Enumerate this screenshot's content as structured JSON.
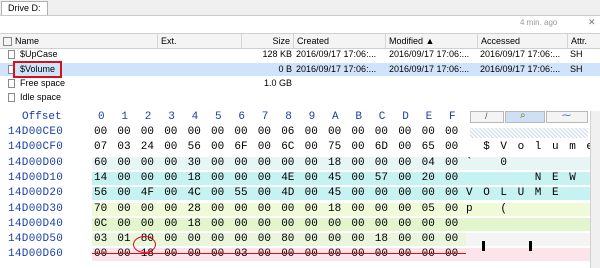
{
  "tab": {
    "label": "Drive D:"
  },
  "status": {
    "time_ago": "4 min. ago"
  },
  "file_list": {
    "columns": [
      "Name",
      "Ext.",
      "Size",
      "Created",
      "Modified",
      "Accessed",
      "Attr."
    ],
    "rows": [
      {
        "name": "$UpCase",
        "ext": "",
        "size": "128 KB",
        "created": "2016/09/17 17:06:...",
        "modified": "2016/09/17 17:06:...",
        "accessed": "2016/09/17 17:06:...",
        "attr": "SH",
        "selected": false
      },
      {
        "name": "$Volume",
        "ext": "",
        "size": "0 B",
        "created": "2016/09/17 17:06:...",
        "modified": "2016/09/17 17:06:...",
        "accessed": "2016/09/17 17:06:...",
        "attr": "SH",
        "selected": true
      },
      {
        "name": "Free space",
        "ext": "",
        "size": "1.0 GB",
        "created": "",
        "modified": "",
        "accessed": "",
        "attr": "",
        "selected": false
      },
      {
        "name": "Idle space",
        "ext": "",
        "size": "",
        "created": "",
        "modified": "",
        "accessed": "",
        "attr": "",
        "selected": false
      }
    ]
  },
  "hex": {
    "offset_label": "Offset",
    "column_labels": [
      "0",
      "1",
      "2",
      "3",
      "4",
      "5",
      "6",
      "7",
      "8",
      "9",
      "A",
      "B",
      "C",
      "D",
      "E",
      "F"
    ],
    "rows": [
      {
        "offset": "14D00CE0",
        "bytes": [
          "00",
          "00",
          "00",
          "00",
          "00",
          "00",
          "00",
          "00",
          "06",
          "00",
          "00",
          "00",
          "00",
          "00",
          "00",
          "00"
        ],
        "text": "",
        "bg": "#ffffff",
        "tbg": "#ffffff"
      },
      {
        "offset": "14D00CF0",
        "bytes": [
          "07",
          "03",
          "24",
          "00",
          "56",
          "00",
          "6F",
          "00",
          "6C",
          "00",
          "75",
          "00",
          "6D",
          "00",
          "65",
          "00"
        ],
        "text": "  $ V o l u m e",
        "bg": "#ffffff",
        "tbg": "#ffffff"
      },
      {
        "offset": "14D00D00",
        "bytes": [
          "60",
          "00",
          "00",
          "00",
          "30",
          "00",
          "00",
          "00",
          "00",
          "00",
          "18",
          "00",
          "00",
          "00",
          "04",
          "00"
        ],
        "text": "`   0",
        "bg": "#e8f5f5",
        "tbg": "#e8f5f5"
      },
      {
        "offset": "14D00D10",
        "bytes": [
          "14",
          "00",
          "00",
          "00",
          "18",
          "00",
          "00",
          "00",
          "4E",
          "00",
          "45",
          "00",
          "57",
          "00",
          "20",
          "00"
        ],
        "text": "        N E W",
        "bg": "#c6f2f2",
        "tbg": "#c6f2f2"
      },
      {
        "offset": "14D00D20",
        "bytes": [
          "56",
          "00",
          "4F",
          "00",
          "4C",
          "00",
          "55",
          "00",
          "4D",
          "00",
          "45",
          "00",
          "00",
          "00",
          "00",
          "00"
        ],
        "text": "V O L U M E",
        "bg": "#c6f2f2",
        "tbg": "#c6f2f2"
      },
      {
        "offset": "14D00D30",
        "bytes": [
          "70",
          "00",
          "00",
          "00",
          "28",
          "00",
          "00",
          "00",
          "00",
          "00",
          "18",
          "00",
          "00",
          "00",
          "05",
          "00"
        ],
        "text": "p   (",
        "bg": "#eefad8",
        "tbg": "#eefad8"
      },
      {
        "offset": "14D00D40",
        "bytes": [
          "0C",
          "00",
          "00",
          "00",
          "18",
          "00",
          "00",
          "00",
          "00",
          "00",
          "00",
          "00",
          "00",
          "00",
          "00",
          "00"
        ],
        "text": "",
        "bg": "#e2f5cc",
        "tbg": "#e2f5cc"
      },
      {
        "offset": "14D00D50",
        "bytes": [
          "03",
          "01",
          "80",
          "00",
          "00",
          "00",
          "00",
          "00",
          "80",
          "00",
          "00",
          "00",
          "18",
          "00",
          "00",
          "00"
        ],
        "text": "",
        "bg": "#e9f6dc",
        "tbg": "#f4f4f4"
      },
      {
        "offset": "14D00D60",
        "bytes": [
          "00",
          "00",
          "18",
          "00",
          "00",
          "00",
          "03",
          "00",
          "00",
          "00",
          "00",
          "00",
          "00",
          "00",
          "00",
          "00"
        ],
        "text": "",
        "bg": "#fde3ea",
        "tbg": "#fde3ea"
      }
    ]
  }
}
